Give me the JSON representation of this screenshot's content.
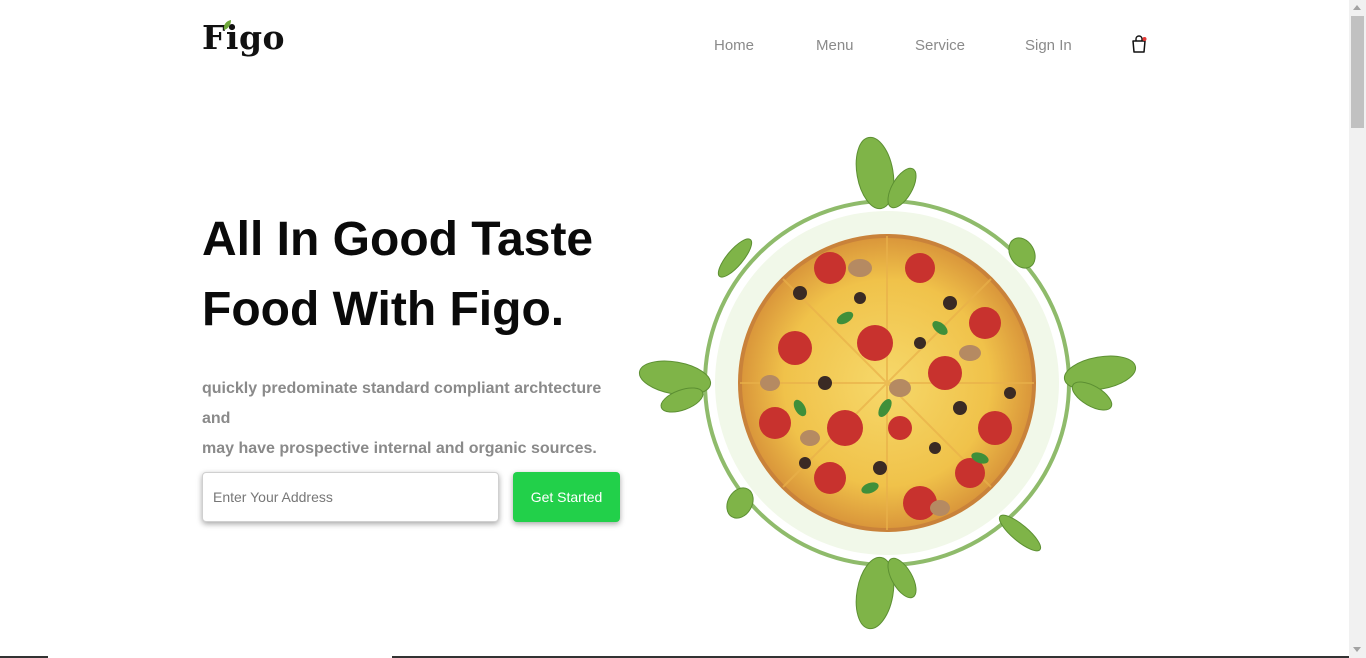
{
  "brand": {
    "name": "Figo",
    "accent": "#22d04a",
    "leaf_color": "#6fa83a"
  },
  "nav": {
    "items": [
      {
        "label": "Home"
      },
      {
        "label": "Menu"
      },
      {
        "label": "Service"
      },
      {
        "label": "Sign In"
      }
    ],
    "cart_icon": "shopping-bag-icon"
  },
  "hero": {
    "headline_line1": "All In Good Taste",
    "headline_line2": "Food With Figo.",
    "description_line1": "quickly predominate standard compliant archtecture and",
    "description_line2": "may have prospective internal and organic sources.",
    "address_placeholder": "Enter Your Address",
    "address_value": "",
    "cta_label": "Get Started"
  },
  "art": {
    "image": "pizza-with-basil-leaves",
    "ring_color": "#8fbb6b"
  }
}
